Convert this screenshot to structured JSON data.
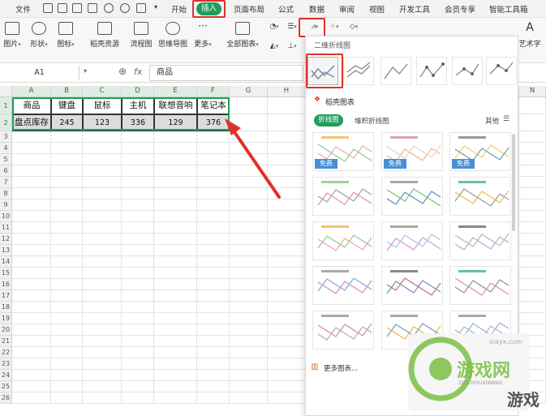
{
  "menu": {
    "file": "文件",
    "tabs": [
      "开始",
      "插入",
      "页面布局",
      "公式",
      "数据",
      "审阅",
      "视图",
      "开发工具",
      "会员专享",
      "智能工具箱"
    ],
    "active_tab": "插入"
  },
  "ribbon": {
    "items": [
      "图片",
      "形状",
      "图标",
      "稻壳资源",
      "流程图",
      "思维导图",
      "更多",
      "全部图表",
      "艺术字"
    ]
  },
  "formula": {
    "cell_ref": "A1",
    "fx": "fx",
    "value": "商品"
  },
  "sheet": {
    "columns": [
      "A",
      "B",
      "C",
      "D",
      "E",
      "F",
      "G",
      "H",
      "",
      "",
      "",
      "",
      "",
      "",
      "N"
    ],
    "rows": [
      "1",
      "2",
      "3",
      "4",
      "5",
      "6",
      "7",
      "8",
      "9",
      "10",
      "11",
      "12",
      "13",
      "14",
      "15",
      "16",
      "17",
      "18",
      "19",
      "20",
      "21",
      "22",
      "23",
      "24",
      "25",
      "26"
    ],
    "table": {
      "header": [
        "商品",
        "键盘",
        "鼠标",
        "主机",
        "联想音响",
        "笔记本"
      ],
      "row": [
        "盘点库存",
        "245",
        "123",
        "336",
        "129",
        "376"
      ]
    }
  },
  "chart_panel": {
    "title": "二维折线图",
    "section": "稻壳图表",
    "filters": [
      "折线图",
      "堆积折线图"
    ],
    "more": "其他",
    "free_badge": "免费",
    "more_charts": "更多图表...",
    "colors": {
      "accent": "#1e9e5a",
      "highlight": "#e0302a",
      "free": "#4a8fd4"
    }
  },
  "watermark": {
    "brand": "游戏网",
    "pinyin": "ZHAOYOUXIWANG",
    "domain": "xiayx.com",
    "tag": "游戏"
  }
}
